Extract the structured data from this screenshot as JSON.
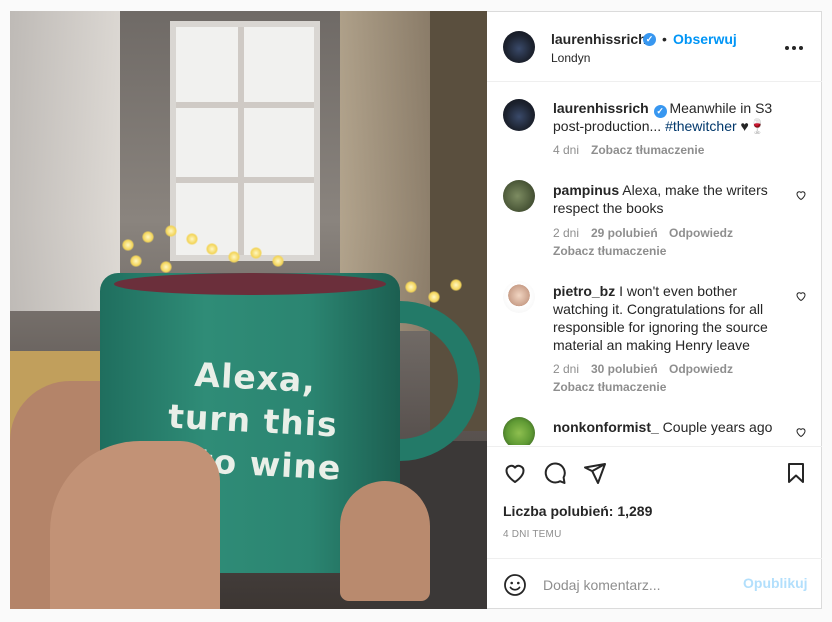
{
  "post": {
    "image_alt": "Green mug reading Alexa, turn this into wine",
    "mug_text": [
      "Alexa,",
      "turn this",
      "into wine"
    ]
  },
  "header": {
    "username": "laurenhissrich",
    "verified": true,
    "separator": "•",
    "follow_label": "Obserwuj",
    "location": "Londyn",
    "more_label": "•••"
  },
  "caption": {
    "username": "laurenhissrich",
    "text_line1": "Meanwhile in S3",
    "text_line2": "post-production...",
    "hashtag": "#thewitcher",
    "emoji": "♥🍷",
    "age": "4 dni",
    "translate_label": "Zobacz tłumaczenie"
  },
  "comments": [
    {
      "username": "pampinus",
      "line1": "Alexa, make the writers",
      "line2": "respect the books",
      "age": "2 dni",
      "likes": "29 polubień",
      "reply_label": "Odpowiedz",
      "translate_label": "Zobacz tłumaczenie"
    },
    {
      "username": "pietro_bz",
      "line1": "I won't even bother",
      "line2": "watching it. Congratulations for all",
      "line3": "responsible for ignoring the source",
      "line4": "material an making Henry leave",
      "age": "2 dni",
      "likes": "30 polubień",
      "reply_label": "Odpowiedz",
      "translate_label": "Zobacz tłumaczenie"
    },
    {
      "username": "nonkonformist_",
      "line1": "Couple years ago"
    }
  ],
  "actions": {
    "likes_text": "Liczba polubień: 1,289",
    "time_text": "4 DNI TEMU"
  },
  "add_comment": {
    "placeholder": "Dodaj komentarz...",
    "post_label": "Opublikuj"
  },
  "colors": {
    "accent": "#0095f6",
    "post_disabled": "#b2dffc",
    "muted": "#8e8e8e",
    "mug_green": "#2f8c77"
  }
}
